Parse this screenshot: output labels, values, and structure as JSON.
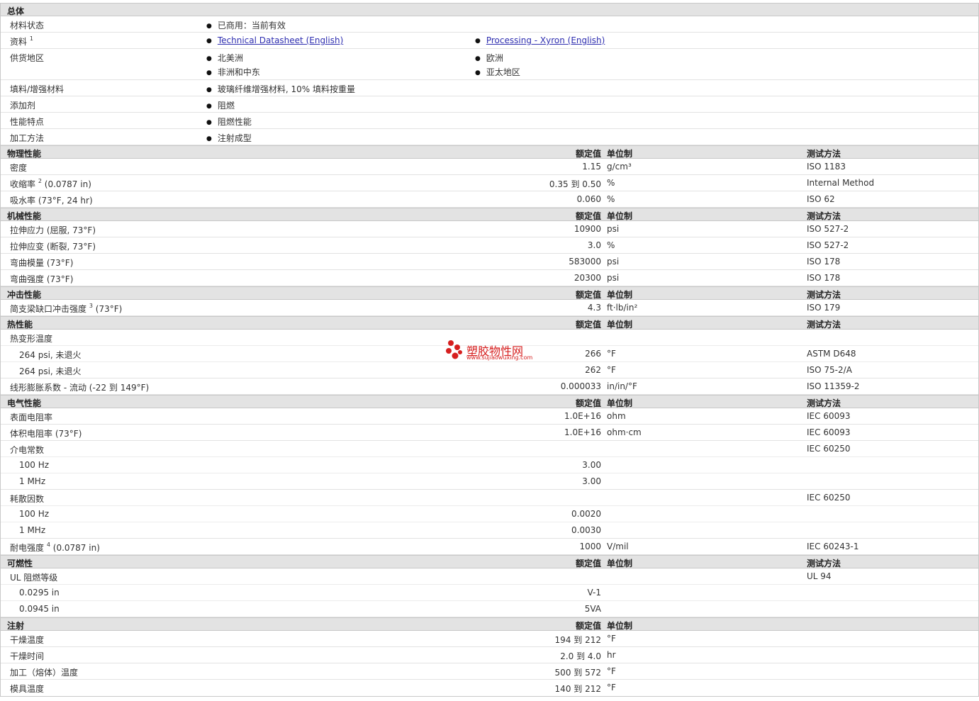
{
  "headers": {
    "rated": "额定值",
    "unit": "单位制",
    "method": "测试方法"
  },
  "general": {
    "title": "总体",
    "status_label": "材料状态",
    "status_value": "已商用：当前有效",
    "docs_label": "资料",
    "docs_sup": "1",
    "doc1": "Technical Datasheet (English)",
    "doc2": "Processing - Xyron (English)",
    "regions_label": "供货地区",
    "regions": [
      "北美洲",
      "欧洲",
      "非洲和中东",
      "亚太地区"
    ],
    "filler_label": "填料/增强材料",
    "filler_value": "玻璃纤维增强材料, 10% 填料按重量",
    "additive_label": "添加剂",
    "additive_value": "阻燃",
    "feature_label": "性能特点",
    "feature_value": "阻燃性能",
    "process_label": "加工方法",
    "process_value": "注射成型"
  },
  "physical": {
    "title": "物理性能",
    "rows": [
      {
        "label": "密度",
        "sup": "",
        "cond": "",
        "value": "1.15",
        "unit": "g/cm³",
        "method": "ISO 1183"
      },
      {
        "label": "收缩率",
        "sup": "2",
        "cond": "(0.0787 in)",
        "value": "0.35 到  0.50",
        "unit": "%",
        "method": "Internal Method"
      },
      {
        "label": "吸水率",
        "sup": "",
        "cond": "(73°F, 24 hr)",
        "value": "0.060",
        "unit": "%",
        "method": "ISO 62"
      }
    ]
  },
  "mechanical": {
    "title": "机械性能",
    "rows": [
      {
        "label": "拉伸应力",
        "cond": "(屈服, 73°F)",
        "value": "10900",
        "unit": "psi",
        "method": "ISO 527-2"
      },
      {
        "label": "拉伸应变",
        "cond": "(断裂, 73°F)",
        "value": "3.0",
        "unit": "%",
        "method": "ISO 527-2"
      },
      {
        "label": "弯曲模量",
        "cond": "(73°F)",
        "value": "583000",
        "unit": "psi",
        "method": "ISO 178"
      },
      {
        "label": "弯曲强度",
        "cond": "(73°F)",
        "value": "20300",
        "unit": "psi",
        "method": "ISO 178"
      }
    ]
  },
  "impact": {
    "title": "冲击性能",
    "label": "简支梁缺口冲击强度",
    "sup": "3",
    "cond": "(73°F)",
    "value": "4.3",
    "unit": "ft·lb/in²",
    "method": "ISO 179"
  },
  "thermal": {
    "title": "热性能",
    "hdt_label": "热变形温度",
    "hdt_rows": [
      {
        "label": "264 psi, 未退火",
        "value": "266",
        "unit": "°F",
        "method": "ASTM D648"
      },
      {
        "label": "264 psi, 未退火",
        "value": "262",
        "unit": "°F",
        "method": "ISO 75-2/A"
      }
    ],
    "clte_label": "线形膨胀系数 - 流动",
    "clte_cond": "(-22 到  149°F)",
    "clte_value": "0.000033",
    "clte_unit": "in/in/°F",
    "clte_method": "ISO 11359-2"
  },
  "electrical": {
    "title": "电气性能",
    "surf_label": "表面电阻率",
    "surf_value": "1.0E+16",
    "surf_unit": "ohm",
    "surf_method": "IEC 60093",
    "vol_label": "体积电阻率",
    "vol_cond": "(73°F)",
    "vol_value": "1.0E+16",
    "vol_unit": "ohm·cm",
    "vol_method": "IEC 60093",
    "diel_label": "介电常数",
    "diel_method": "IEC 60250",
    "diel_rows": [
      {
        "label": "100 Hz",
        "value": "3.00"
      },
      {
        "label": "1 MHz",
        "value": "3.00"
      }
    ],
    "diss_label": "耗散因数",
    "diss_method": "IEC 60250",
    "diss_rows": [
      {
        "label": "100 Hz",
        "value": "0.0020"
      },
      {
        "label": "1 MHz",
        "value": "0.0030"
      }
    ],
    "str_label": "耐电强度",
    "str_sup": "4",
    "str_cond": "(0.0787 in)",
    "str_value": "1000",
    "str_unit": "V/mil",
    "str_method": "IEC 60243-1"
  },
  "flammability": {
    "title": "可燃性",
    "ul_label": "UL 阻燃等级",
    "ul_method": "UL 94",
    "rows": [
      {
        "label": "0.0295 in",
        "value": "V-1"
      },
      {
        "label": "0.0945 in",
        "value": "5VA"
      }
    ]
  },
  "injection": {
    "title": "注射",
    "rows": [
      {
        "label": "干燥温度",
        "value": "194 到  212",
        "unit": "°F"
      },
      {
        "label": "干燥时间",
        "value": "2.0 到  4.0",
        "unit": "hr"
      },
      {
        "label": "加工（熔体）温度",
        "value": "500 到  572",
        "unit": "°F"
      },
      {
        "label": "模具温度",
        "value": "140 到  212",
        "unit": "°F"
      }
    ]
  },
  "watermark": {
    "name": "塑胶物性网",
    "url": "www.sujiaowuxing.com"
  },
  "colors": {
    "header_bg": "#e3e3e3",
    "link": "#2f2fb0",
    "logo": "#d61f1f"
  }
}
